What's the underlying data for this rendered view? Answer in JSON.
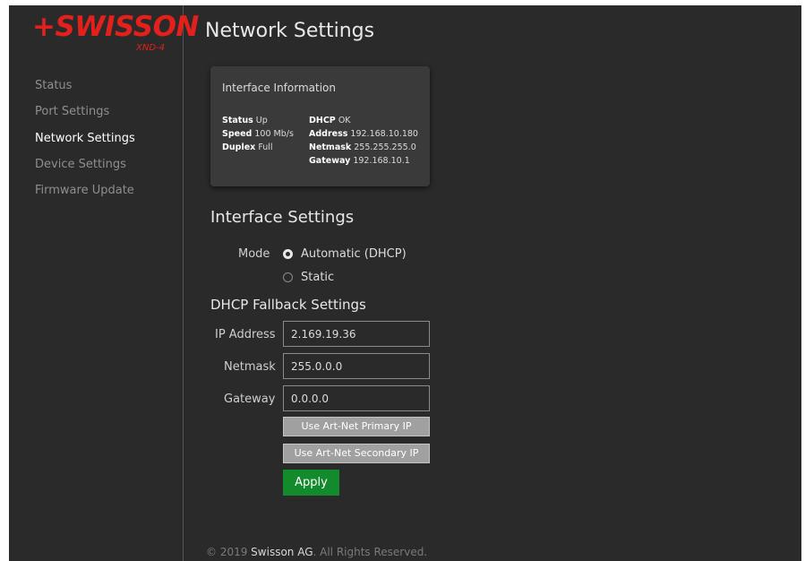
{
  "brand": {
    "logo_text": "+SWISSON",
    "model": "XND-4",
    "accent": "#e3201b"
  },
  "sidebar": {
    "items": [
      {
        "label": "Status",
        "active": false
      },
      {
        "label": "Port Settings",
        "active": false
      },
      {
        "label": "Network Settings",
        "active": true
      },
      {
        "label": "Device Settings",
        "active": false
      },
      {
        "label": "Firmware Update",
        "active": false
      }
    ]
  },
  "page": {
    "title": "Network Settings"
  },
  "interface_info": {
    "title": "Interface Information",
    "status_label": "Status",
    "status_value": "Up",
    "speed_label": "Speed",
    "speed_value": "100 Mb/s",
    "duplex_label": "Duplex",
    "duplex_value": "Full",
    "dhcp_label": "DHCP",
    "dhcp_value": "OK",
    "address_label": "Address",
    "address_value": "192.168.10.180",
    "netmask_label": "Netmask",
    "netmask_value": "255.255.255.0",
    "gateway_label": "Gateway",
    "gateway_value": "192.168.10.1"
  },
  "interface_settings": {
    "title": "Interface Settings",
    "mode_label": "Mode",
    "options": [
      {
        "label": "Automatic (DHCP)",
        "selected": true
      },
      {
        "label": "Static",
        "selected": false
      }
    ]
  },
  "fallback": {
    "title": "DHCP Fallback Settings",
    "ip_label": "IP Address",
    "ip_value": "2.169.19.36",
    "netmask_label": "Netmask",
    "netmask_value": "255.0.0.0",
    "gateway_label": "Gateway",
    "gateway_value": "0.0.0.0",
    "primary_button": "Use Art-Net Primary IP",
    "secondary_button": "Use Art-Net Secondary IP",
    "apply_button": "Apply"
  },
  "footer": {
    "prefix": "© 2019 ",
    "company": "Swisson AG",
    "suffix": ". All Rights Reserved."
  },
  "colors": {
    "background": "#2a2a2a",
    "apply_green": "#138a2c",
    "button_gray": "#a0a0a0"
  }
}
